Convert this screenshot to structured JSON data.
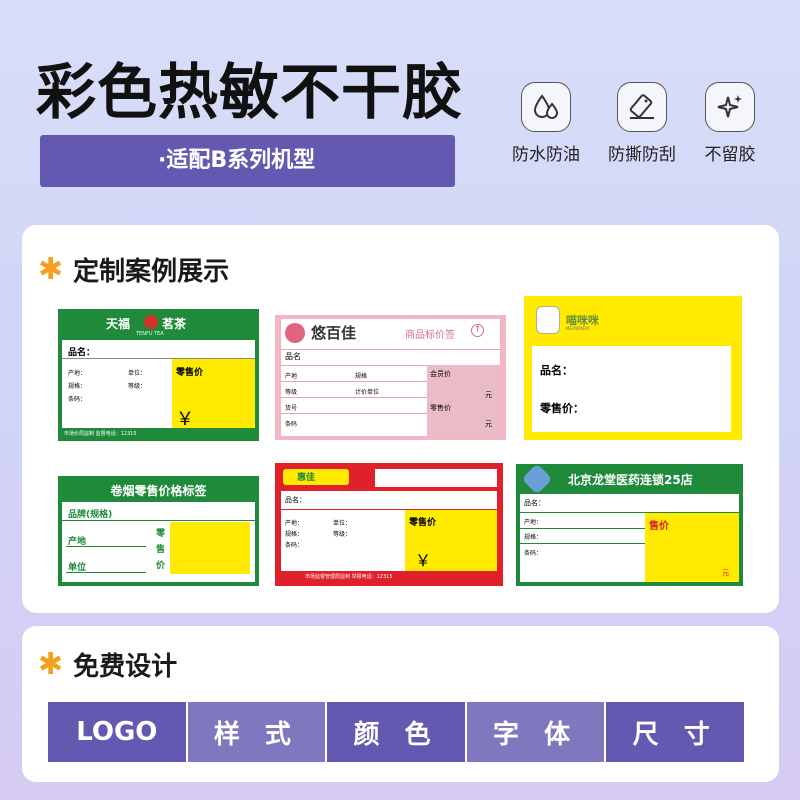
{
  "header": {
    "title": "彩色热敏不干胶",
    "subtitle": "·适配B系列机型"
  },
  "features": [
    {
      "icon": "water-drop-icon",
      "label": "防水防油"
    },
    {
      "icon": "tear-scratch-icon",
      "label": "防撕防刮"
    },
    {
      "icon": "sparkle-icon",
      "label": "不留胶"
    }
  ],
  "showcase": {
    "heading": "定制案例展示",
    "labels": {
      "tianfu": {
        "brand": "天福",
        "brand2": "茗茶",
        "sub": "TENFU TEA",
        "name": "品名：",
        "origin": "产地：",
        "unit": "单位：",
        "spec": "规格：",
        "grade": "等级：",
        "barcode": "条码：",
        "price": "零售价",
        "yen": "￥",
        "footer": "市场价局监制    监督电话：12315"
      },
      "youbaijia": {
        "brand": "悠百佳",
        "tag": "商品标价签",
        "name": "品名",
        "origin": "产地",
        "spec": "规格",
        "grade": "等级",
        "unit": "计价单位",
        "member": "会员价",
        "retail": "零售价",
        "yuan1": "元",
        "yuan2": "元",
        "item": "货号",
        "barcode": "条码"
      },
      "meow": {
        "brand": "喵咪咪",
        "sub": "MEOWMEW",
        "name": "品名：",
        "price": "零售价："
      },
      "tobacco": {
        "title": "卷烟零售价格标签",
        "brand": "品牌(规格)",
        "origin": "产地",
        "unit": "单位",
        "price1": "零",
        "price2": "售",
        "price3": "价"
      },
      "red": {
        "brand": "惠佳",
        "name": "品名：",
        "origin": "产地：",
        "unit": "单位：",
        "spec": "规格：",
        "grade": "等级：",
        "barcode": "条码：",
        "price": "零售价",
        "yen": "￥",
        "footer": "市场监督管理局监制    举报电话：12315"
      },
      "pharmacy": {
        "title": "北京龙堂医药连锁25店",
        "name": "品名：",
        "origin": "产地：",
        "spec": "规格：",
        "barcode": "条码：",
        "price": "售价",
        "yuan": "元"
      }
    }
  },
  "design": {
    "heading": "免费设计",
    "tags": [
      "LOGO",
      "样 式",
      "颜 色",
      "字 体",
      "尺 寸"
    ]
  },
  "colors": {
    "purple": "#6459b0",
    "purple_light": "#7f78bf",
    "star": "#f5a11e",
    "green": "#1e8a3a",
    "yellow": "#ffea00",
    "pink": "#f3b6c3",
    "red": "#e0202a"
  }
}
